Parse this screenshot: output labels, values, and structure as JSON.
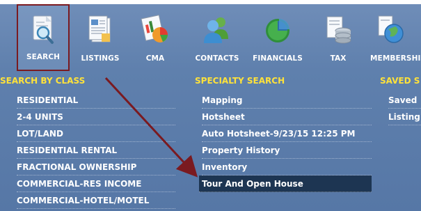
{
  "toolbar": {
    "items": [
      {
        "label": "SEARCH",
        "icon": "search-document-icon",
        "selected": true
      },
      {
        "label": "LISTINGS",
        "icon": "listings-document-icon"
      },
      {
        "label": "CMA",
        "icon": "cma-chart-icon"
      },
      {
        "label": "CONTACTS",
        "icon": "contacts-people-icon"
      },
      {
        "label": "FINANCIALS",
        "icon": "financials-pie-icon"
      },
      {
        "label": "TAX",
        "icon": "tax-database-icon"
      },
      {
        "label": "MEMBERSHI",
        "icon": "membership-globe-icon"
      }
    ]
  },
  "search_by_class": {
    "title": "SEARCH BY CLASS",
    "items": [
      "RESIDENTIAL",
      "2-4 UNITS",
      "LOT/LAND",
      "RESIDENTIAL RENTAL",
      "FRACTIONAL OWNERSHIP",
      "COMMERCIAL-RES INCOME",
      "COMMERCIAL-HOTEL/MOTEL"
    ]
  },
  "specialty_search": {
    "title": "SPECIALTY SEARCH",
    "items": [
      "Mapping",
      "Hotsheet",
      "Auto Hotsheet-9/23/15 12:25 PM",
      "Property History",
      "Inventory",
      "Tour And Open House"
    ],
    "highlighted": "Tour And Open House"
  },
  "saved_search": {
    "title": "SAVED S",
    "items": [
      "Saved",
      "Listing"
    ]
  },
  "colors": {
    "background": "#5f80ad",
    "heading": "#ffe23a",
    "highlight": "#1d3552",
    "selected_border": "#7a1a20",
    "arrow": "#7a1a20"
  }
}
